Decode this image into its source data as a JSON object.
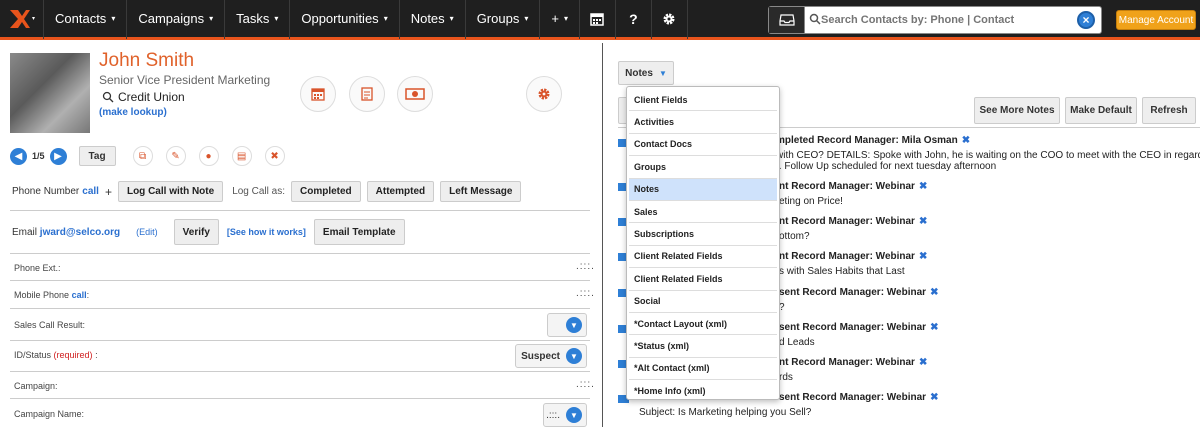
{
  "nav": {
    "items": [
      {
        "label": "Contacts",
        "caret": "▾"
      },
      {
        "label": "Campaigns",
        "caret": "▾"
      },
      {
        "label": "Tasks",
        "caret": "▾"
      },
      {
        "label": "Opportunities",
        "caret": "▾"
      },
      {
        "label": "Notes",
        "caret": "▾"
      },
      {
        "label": "Groups",
        "caret": "▾"
      },
      {
        "label": "+",
        "caret": "▾"
      }
    ],
    "icons": [
      "calendar-icon",
      "help-icon",
      "gear-icon"
    ],
    "help_glyph": "?",
    "search_placeholder": "Search Contacts by: Phone | Contact",
    "manage_label": "Manage Account",
    "accent": "#e8541c"
  },
  "contact": {
    "name": "John Smith",
    "title": "Senior Vice President Marketing",
    "company": "Credit Union",
    "make_lookup": "(make lookup)",
    "pager": "1/5",
    "tag_label": "Tag"
  },
  "phone_row": {
    "label": "Phone Number",
    "call": "call",
    "plus": "+",
    "log_call_with_note": "Log Call with Note",
    "log_call_as": "Log Call as:",
    "completed": "Completed",
    "attempted": "Attempted",
    "left_message": "Left Message"
  },
  "email_row": {
    "label": "Email",
    "email": "jward@selco.org",
    "edit": "(Edit)",
    "verify": "Verify",
    "see_how": "[See how it works]",
    "template": "Email Template"
  },
  "fields": {
    "phone_ext": "Phone Ext.:",
    "mobile_phone": "Mobile Phone",
    "mobile_call": "call",
    "mobile_colon": ":",
    "sales_call_result": "Sales Call Result:",
    "id_status": "ID/Status",
    "required": "(required)",
    "id_colon": ":",
    "id_status_value": "Suspect",
    "campaign": "Campaign:",
    "campaign_name": "Campaign Name:",
    "dots": ".:::."
  },
  "notes_panel": {
    "notes_button": "Notes",
    "see_more": "See More Notes",
    "make_default": "Make Default",
    "refresh": "Refresh",
    "entries": [
      {
        "head": "mpleted  Record Manager: Mila Osman",
        "lines": [
          "with CEO? DETAILS: Spoke with John, he is waiting on the COO to meet with the CEO in regards to",
          "I. Follow Up scheduled for next tuesday afternoon"
        ]
      },
      {
        "head": "nt  Record Manager: Webinar",
        "lines": [
          "eting on Price!"
        ]
      },
      {
        "head": "nt  Record Manager: Webinar",
        "lines": [
          "ottom?"
        ]
      },
      {
        "head": "nt  Record Manager: Webinar",
        "lines": [
          "s with Sales Habits that Last"
        ]
      },
      {
        "head": "sent  Record Manager: Webinar",
        "lines": [
          "?"
        ]
      },
      {
        "head": "sent  Record Manager: Webinar",
        "lines": [
          "d Leads"
        ]
      },
      {
        "head": "nt  Record Manager: Webinar",
        "lines": [
          "rds"
        ]
      },
      {
        "head": "sent  Record Manager: Webinar",
        "lines": [
          "Subject: Is Marketing helping you Sell?"
        ]
      }
    ]
  },
  "dropdown": {
    "items": [
      "Client Fields",
      "Activities",
      "Contact Docs",
      "Groups",
      "Notes",
      "Sales",
      "Subscriptions",
      "Client Related Fields",
      "Client Related Fields",
      "Social",
      "*Contact Layout (xml)",
      "*Status (xml)",
      "*Alt Contact (xml)",
      "*Home Info (xml)"
    ],
    "selected": "Notes"
  }
}
